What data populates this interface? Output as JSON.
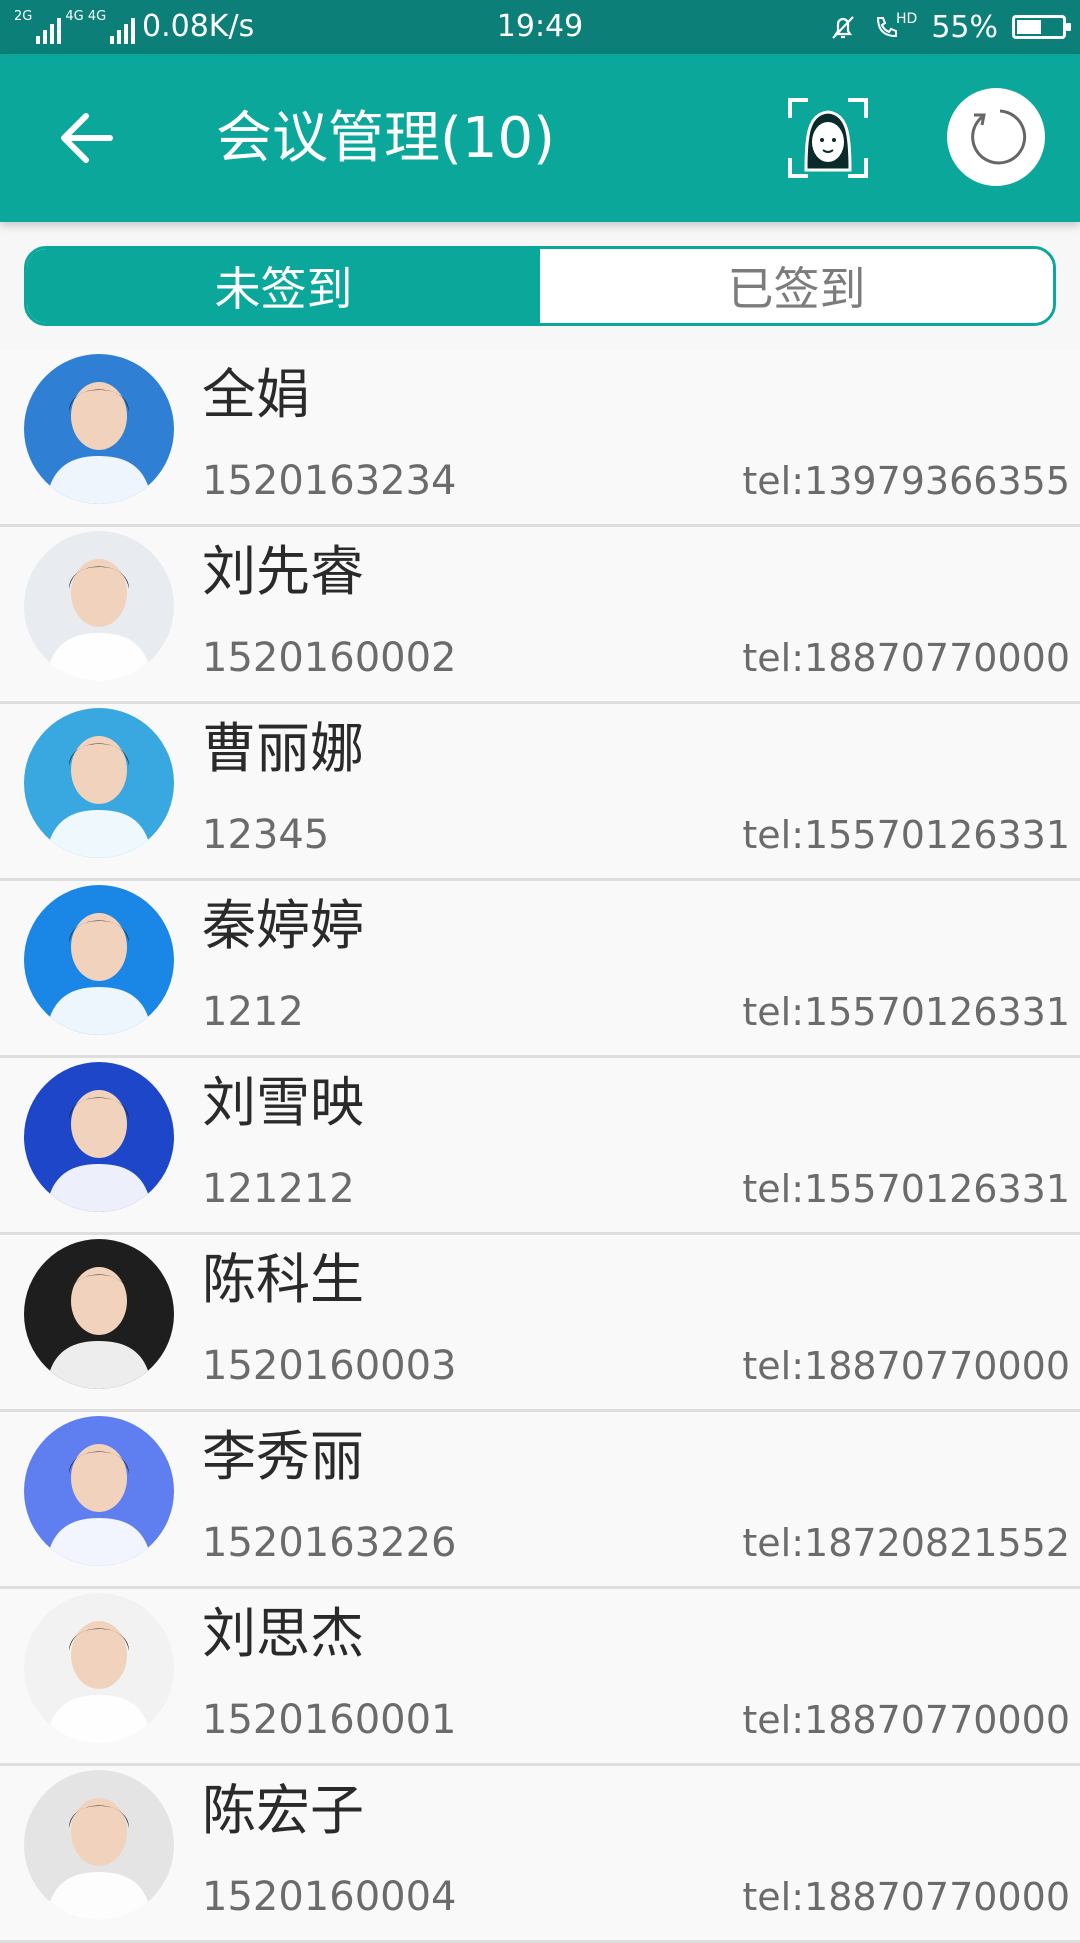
{
  "status_bar": {
    "network_1": "2G",
    "network_2": "4G 4G",
    "speed": "0.08K/s",
    "time": "19:49",
    "hd_label": "HD",
    "battery_percent": "55%",
    "battery_level": 0.55,
    "icons": [
      "mute-bell-icon",
      "hd-call-icon",
      "battery-icon"
    ]
  },
  "appbar": {
    "title": "会议管理(10)",
    "back_icon": "arrow-left-icon",
    "face_icon": "face-scan-icon",
    "refresh_icon": "refresh-icon",
    "color": "#0aa79a"
  },
  "tabs": [
    {
      "label": "未签到",
      "active": true
    },
    {
      "label": "已签到",
      "active": false
    }
  ],
  "attendees": [
    {
      "name": "全娟",
      "code": "1520163234",
      "tel": "tel:13979366355",
      "bg": "#2f7fd4"
    },
    {
      "name": "刘先睿",
      "code": "1520160002",
      "tel": "tel:18870770000",
      "bg": "#e8ecf0"
    },
    {
      "name": "曹丽娜",
      "code": "12345",
      "tel": "tel:15570126331",
      "bg": "#3aa8e0"
    },
    {
      "name": "秦婷婷",
      "code": "1212",
      "tel": "tel:15570126331",
      "bg": "#1a86e6"
    },
    {
      "name": "刘雪映",
      "code": "121212",
      "tel": "tel:15570126331",
      "bg": "#1d47c8"
    },
    {
      "name": "陈科生",
      "code": "1520160003",
      "tel": "tel:18870770000",
      "bg": "#1e1e1e"
    },
    {
      "name": "李秀丽",
      "code": "1520163226",
      "tel": "tel:18720821552",
      "bg": "#5f7ff0"
    },
    {
      "name": "刘思杰",
      "code": "1520160001",
      "tel": "tel:18870770000",
      "bg": "#f2f2f2"
    },
    {
      "name": "陈宏子",
      "code": "1520160004",
      "tel": "tel:18870770000",
      "bg": "#e4e4e4"
    }
  ]
}
